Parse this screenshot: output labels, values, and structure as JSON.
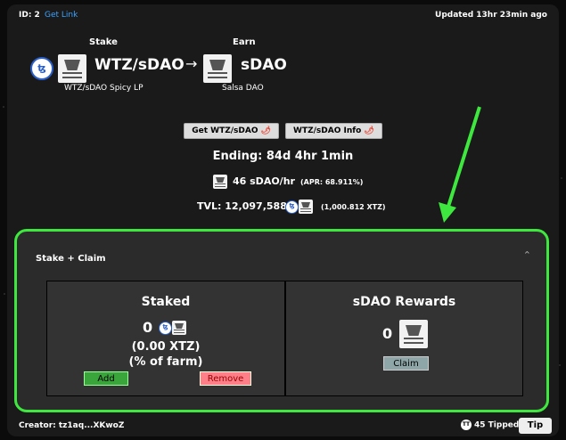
{
  "header": {
    "id_label": "ID: 2",
    "get_link": "Get Link",
    "updated": "Updated 13hr 23min ago"
  },
  "pair": {
    "stake_header": "Stake",
    "earn_header": "Earn",
    "stake_token": "WTZ/sDAO",
    "earn_token": "sDAO",
    "stake_sub": "WTZ/sDAO Spicy LP",
    "earn_sub": "Salsa DAO",
    "arrow": "→",
    "tz_icon_text": "ꜩ"
  },
  "buttons": {
    "get": "Get WTZ/sDAO",
    "info": "WTZ/sDAO Info",
    "chili": "🌶"
  },
  "stats": {
    "ending": "Ending: 84d 4hr 1min",
    "rate": "46 sDAO/hr",
    "apr": "(APR: 68.911%)",
    "tvl": "TVL: 12,097,588",
    "tvl_xtz": "(1,000.812 XTZ)"
  },
  "panel": {
    "title": "Stake + Claim",
    "chevron": "⌃",
    "staked_title": "Staked",
    "staked_value": "0",
    "staked_xtz": "(0.00 XTZ)",
    "staked_pct": "(% of farm)",
    "add": "Add",
    "remove": "Remove",
    "rewards_title": "sDAO Rewards",
    "rewards_value": "0",
    "claim": "Claim"
  },
  "footer": {
    "creator": "Creator: tz1aq...XKwoZ",
    "tipped": "45 Tipped",
    "tip_avatar": "TT",
    "tip": "Tip"
  },
  "colors": {
    "accent_green": "#3ee83e",
    "link_blue": "#3aa3ff",
    "add_green": "#3aa53a",
    "remove_pink": "#ff7f88"
  }
}
